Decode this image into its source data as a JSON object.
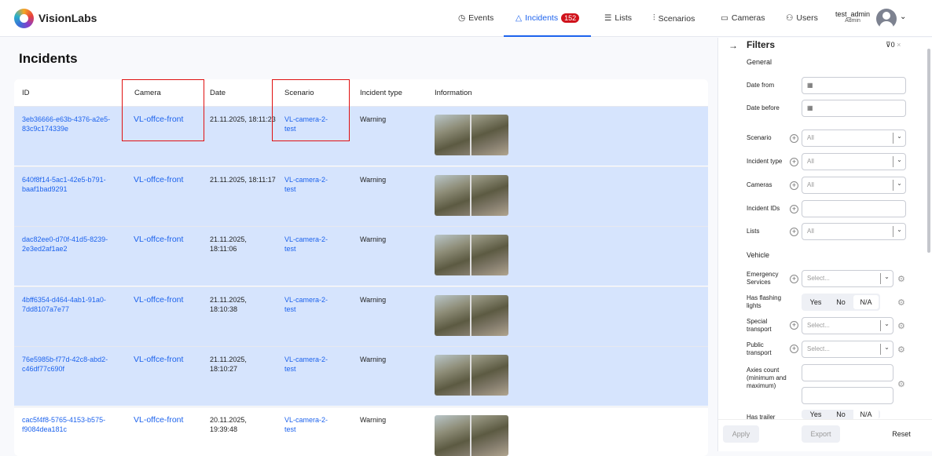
{
  "header": {
    "brand": "VisionLabs",
    "nav": [
      {
        "label": "Events",
        "icon": "clock-icon"
      },
      {
        "label": "Incidents",
        "icon": "warning-icon",
        "badge": "152"
      },
      {
        "label": "Lists",
        "icon": "list-icon"
      },
      {
        "label": "Scenarios",
        "icon": "sliders-icon"
      },
      {
        "label": "Cameras",
        "icon": "camera-icon"
      },
      {
        "label": "Users",
        "icon": "users-icon"
      }
    ],
    "user": {
      "name": "test_admin",
      "role": "Admin"
    }
  },
  "page": {
    "title": "Incidents"
  },
  "table": {
    "columns": [
      "ID",
      "Camera",
      "Date",
      "Scenario",
      "Incident type",
      "Information"
    ],
    "rows": [
      {
        "id": "3eb36666-e63b-4376-a2e5-83c9c174339e",
        "camera": "VL-offce-front",
        "date": "21.11.2025, 18:11:23",
        "scenario": "VL-camera-2-test",
        "type": "Warning"
      },
      {
        "id": "640f8f14-5ac1-42e5-b791-baaf1bad9291",
        "camera": "VL-offce-front",
        "date": "21.11.2025, 18:11:17",
        "scenario": "VL-camera-2-test",
        "type": "Warning"
      },
      {
        "id": "dac82ee0-d70f-41d5-8239-2e3ed2af1ae2",
        "camera": "VL-offce-front",
        "date": "21.11.2025, 18:11:06",
        "scenario": "VL-camera-2-test",
        "type": "Warning"
      },
      {
        "id": "4bff6354-d464-4ab1-91a0-7dd8107a7e77",
        "camera": "VL-offce-front",
        "date": "21.11.2025, 18:10:38",
        "scenario": "VL-camera-2-test",
        "type": "Warning"
      },
      {
        "id": "76e5985b-f77d-42c8-abd2-c46df77c690f",
        "camera": "VL-offce-front",
        "date": "21.11.2025, 18:10:27",
        "scenario": "VL-camera-2-test",
        "type": "Warning"
      },
      {
        "id": "cac5f4f8-5765-4153-b575-f9084dea181c",
        "camera": "VL-offce-front",
        "date": "20.11.2025, 19:39:48",
        "scenario": "VL-camera-2-test",
        "type": "Warning"
      }
    ]
  },
  "filters": {
    "title": "Filters",
    "count": "0",
    "general": "General",
    "date_from": "Date from",
    "date_before": "Date before",
    "selects": [
      {
        "label": "Scenario",
        "value": "All"
      },
      {
        "label": "Incident type",
        "value": "All"
      },
      {
        "label": "Cameras",
        "value": "All"
      }
    ],
    "incident_ids": "Incident IDs",
    "lists": {
      "label": "Lists",
      "value": "All"
    },
    "vehicle": "Vehicle",
    "emergency": "Emergency Services",
    "flashing": "Has flashing lights",
    "special": "Special transport",
    "public": "Public transport",
    "axles": "Axies count (minimum and maximum)",
    "trailer": "Has trailer",
    "placeholder": "Select...",
    "yes": "Yes",
    "no": "No",
    "na": "N/A",
    "apply": "Apply",
    "export": "Export",
    "reset": "Reset"
  }
}
